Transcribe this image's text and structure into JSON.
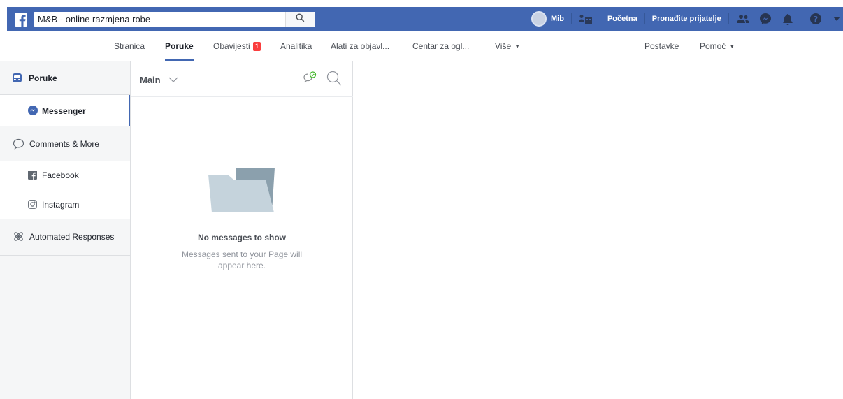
{
  "topbar": {
    "search_value": "M&B - online razmjena robe",
    "search_placeholder": "Search",
    "user_name": "Mib",
    "home_label": "Početna",
    "find_friends_label": "Pronađite prijatelje",
    "brand_color": "#4267b2"
  },
  "subnav": {
    "items": [
      {
        "label": "Stranica"
      },
      {
        "label": "Poruke"
      },
      {
        "label": "Obavijesti"
      },
      {
        "label": "Analitika"
      },
      {
        "label": "Alati za objavl..."
      },
      {
        "label": "Centar za ogl..."
      },
      {
        "label": "Više"
      }
    ],
    "notifications_badge": "1",
    "more_caret": "▼",
    "settings_label": "Postavke",
    "help_label": "Pomoć",
    "help_caret": "▼"
  },
  "sidebar": {
    "poruke_label": "Poruke",
    "messenger_label": "Messenger",
    "comments_label": "Comments & More",
    "facebook_label": "Facebook",
    "instagram_label": "Instagram",
    "automated_label": "Automated Responses"
  },
  "inbox": {
    "filter_label": "Main",
    "empty_title": "No messages to show",
    "empty_description": "Messages sent to your Page will appear here."
  },
  "icons": {
    "logo": "facebook-logo-icon",
    "search": "search-icon",
    "friend_requests": "friend-requests-icon",
    "messenger": "messenger-icon",
    "notifications": "bell-icon",
    "help": "help-icon",
    "account_menu": "caret-down-icon"
  }
}
